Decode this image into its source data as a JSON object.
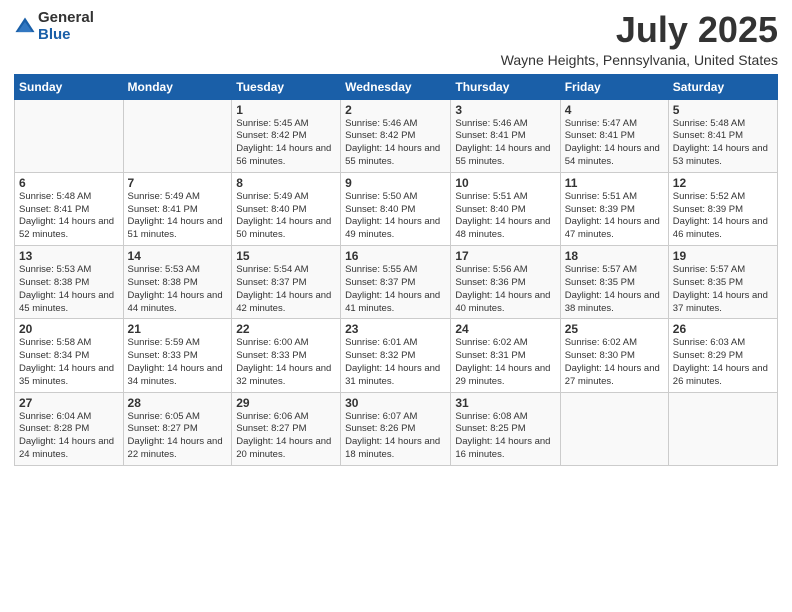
{
  "logo": {
    "general": "General",
    "blue": "Blue"
  },
  "title": "July 2025",
  "subtitle": "Wayne Heights, Pennsylvania, United States",
  "headers": [
    "Sunday",
    "Monday",
    "Tuesday",
    "Wednesday",
    "Thursday",
    "Friday",
    "Saturday"
  ],
  "weeks": [
    [
      {
        "day": "",
        "info": ""
      },
      {
        "day": "",
        "info": ""
      },
      {
        "day": "1",
        "info": "Sunrise: 5:45 AM\nSunset: 8:42 PM\nDaylight: 14 hours and 56 minutes."
      },
      {
        "day": "2",
        "info": "Sunrise: 5:46 AM\nSunset: 8:42 PM\nDaylight: 14 hours and 55 minutes."
      },
      {
        "day": "3",
        "info": "Sunrise: 5:46 AM\nSunset: 8:41 PM\nDaylight: 14 hours and 55 minutes."
      },
      {
        "day": "4",
        "info": "Sunrise: 5:47 AM\nSunset: 8:41 PM\nDaylight: 14 hours and 54 minutes."
      },
      {
        "day": "5",
        "info": "Sunrise: 5:48 AM\nSunset: 8:41 PM\nDaylight: 14 hours and 53 minutes."
      }
    ],
    [
      {
        "day": "6",
        "info": "Sunrise: 5:48 AM\nSunset: 8:41 PM\nDaylight: 14 hours and 52 minutes."
      },
      {
        "day": "7",
        "info": "Sunrise: 5:49 AM\nSunset: 8:41 PM\nDaylight: 14 hours and 51 minutes."
      },
      {
        "day": "8",
        "info": "Sunrise: 5:49 AM\nSunset: 8:40 PM\nDaylight: 14 hours and 50 minutes."
      },
      {
        "day": "9",
        "info": "Sunrise: 5:50 AM\nSunset: 8:40 PM\nDaylight: 14 hours and 49 minutes."
      },
      {
        "day": "10",
        "info": "Sunrise: 5:51 AM\nSunset: 8:40 PM\nDaylight: 14 hours and 48 minutes."
      },
      {
        "day": "11",
        "info": "Sunrise: 5:51 AM\nSunset: 8:39 PM\nDaylight: 14 hours and 47 minutes."
      },
      {
        "day": "12",
        "info": "Sunrise: 5:52 AM\nSunset: 8:39 PM\nDaylight: 14 hours and 46 minutes."
      }
    ],
    [
      {
        "day": "13",
        "info": "Sunrise: 5:53 AM\nSunset: 8:38 PM\nDaylight: 14 hours and 45 minutes."
      },
      {
        "day": "14",
        "info": "Sunrise: 5:53 AM\nSunset: 8:38 PM\nDaylight: 14 hours and 44 minutes."
      },
      {
        "day": "15",
        "info": "Sunrise: 5:54 AM\nSunset: 8:37 PM\nDaylight: 14 hours and 42 minutes."
      },
      {
        "day": "16",
        "info": "Sunrise: 5:55 AM\nSunset: 8:37 PM\nDaylight: 14 hours and 41 minutes."
      },
      {
        "day": "17",
        "info": "Sunrise: 5:56 AM\nSunset: 8:36 PM\nDaylight: 14 hours and 40 minutes."
      },
      {
        "day": "18",
        "info": "Sunrise: 5:57 AM\nSunset: 8:35 PM\nDaylight: 14 hours and 38 minutes."
      },
      {
        "day": "19",
        "info": "Sunrise: 5:57 AM\nSunset: 8:35 PM\nDaylight: 14 hours and 37 minutes."
      }
    ],
    [
      {
        "day": "20",
        "info": "Sunrise: 5:58 AM\nSunset: 8:34 PM\nDaylight: 14 hours and 35 minutes."
      },
      {
        "day": "21",
        "info": "Sunrise: 5:59 AM\nSunset: 8:33 PM\nDaylight: 14 hours and 34 minutes."
      },
      {
        "day": "22",
        "info": "Sunrise: 6:00 AM\nSunset: 8:33 PM\nDaylight: 14 hours and 32 minutes."
      },
      {
        "day": "23",
        "info": "Sunrise: 6:01 AM\nSunset: 8:32 PM\nDaylight: 14 hours and 31 minutes."
      },
      {
        "day": "24",
        "info": "Sunrise: 6:02 AM\nSunset: 8:31 PM\nDaylight: 14 hours and 29 minutes."
      },
      {
        "day": "25",
        "info": "Sunrise: 6:02 AM\nSunset: 8:30 PM\nDaylight: 14 hours and 27 minutes."
      },
      {
        "day": "26",
        "info": "Sunrise: 6:03 AM\nSunset: 8:29 PM\nDaylight: 14 hours and 26 minutes."
      }
    ],
    [
      {
        "day": "27",
        "info": "Sunrise: 6:04 AM\nSunset: 8:28 PM\nDaylight: 14 hours and 24 minutes."
      },
      {
        "day": "28",
        "info": "Sunrise: 6:05 AM\nSunset: 8:27 PM\nDaylight: 14 hours and 22 minutes."
      },
      {
        "day": "29",
        "info": "Sunrise: 6:06 AM\nSunset: 8:27 PM\nDaylight: 14 hours and 20 minutes."
      },
      {
        "day": "30",
        "info": "Sunrise: 6:07 AM\nSunset: 8:26 PM\nDaylight: 14 hours and 18 minutes."
      },
      {
        "day": "31",
        "info": "Sunrise: 6:08 AM\nSunset: 8:25 PM\nDaylight: 14 hours and 16 minutes."
      },
      {
        "day": "",
        "info": ""
      },
      {
        "day": "",
        "info": ""
      }
    ]
  ]
}
